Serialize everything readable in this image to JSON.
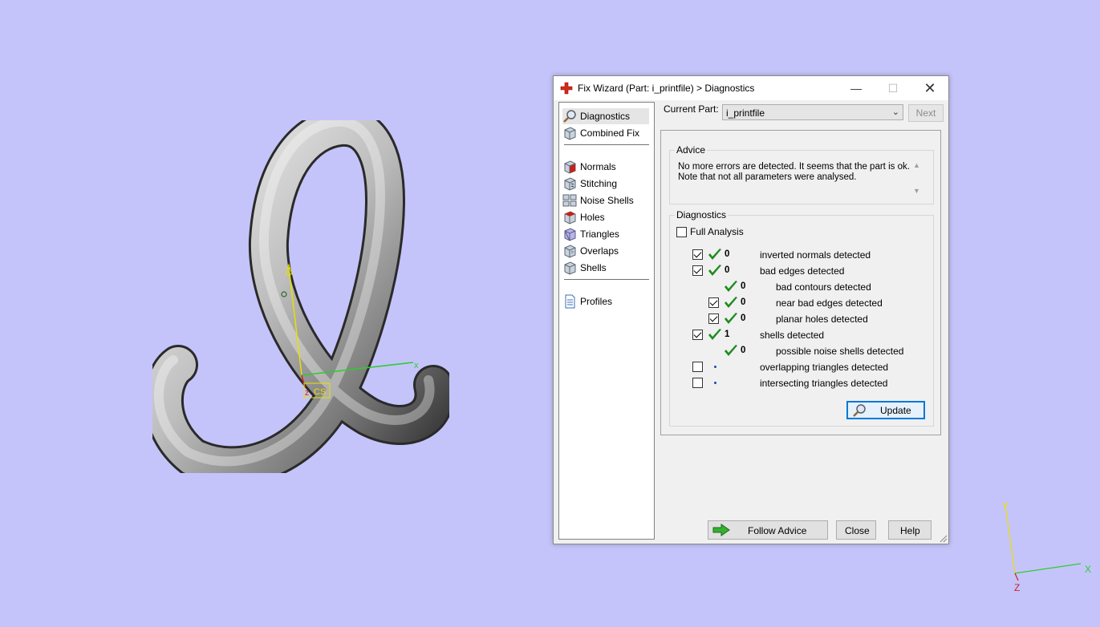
{
  "window": {
    "title": "Fix Wizard (Part: i_printfile) > Diagnostics",
    "min_glyph": "—",
    "max_glyph": "☐",
    "close_glyph": "✕"
  },
  "nav": {
    "items": [
      {
        "label": "Diagnostics",
        "icon": "magnifier-icon",
        "selected": true
      },
      {
        "label": "Combined Fix",
        "icon": "cube-icon"
      },
      {
        "label": "Normals",
        "icon": "normals-cube-icon"
      },
      {
        "label": "Stitching",
        "icon": "stitching-cube-icon"
      },
      {
        "label": "Noise Shells",
        "icon": "noise-shells-icon"
      },
      {
        "label": "Holes",
        "icon": "holes-cube-icon"
      },
      {
        "label": "Triangles",
        "icon": "triangles-cube-icon"
      },
      {
        "label": "Overlaps",
        "icon": "overlaps-cube-icon"
      },
      {
        "label": "Shells",
        "icon": "shells-cube-icon"
      },
      {
        "label": "Profiles",
        "icon": "document-icon"
      }
    ]
  },
  "current_part": {
    "label": "Current Part:",
    "value": "i_printfile",
    "next_label": "Next"
  },
  "advice": {
    "title": "Advice",
    "text": "No more errors are detected. It seems that the part is ok. Note that not all parameters were analysed."
  },
  "diagnostics": {
    "title": "Diagnostics",
    "full_analysis_label": "Full Analysis",
    "full_analysis_checked": false,
    "rows": [
      {
        "label": "inverted normals detected",
        "count": "0",
        "checked": true,
        "status": "ok",
        "level": 0,
        "has_checkbox": true
      },
      {
        "label": "bad edges detected",
        "count": "0",
        "checked": true,
        "status": "ok",
        "level": 0,
        "has_checkbox": true
      },
      {
        "label": "bad contours detected",
        "count": "0",
        "checked": false,
        "status": "ok",
        "level": 1,
        "has_checkbox": false
      },
      {
        "label": "near bad edges detected",
        "count": "0",
        "checked": true,
        "status": "ok",
        "level": 1,
        "has_checkbox": true
      },
      {
        "label": "planar holes detected",
        "count": "0",
        "checked": true,
        "status": "ok",
        "level": 1,
        "has_checkbox": true
      },
      {
        "label": "shells detected",
        "count": "1",
        "checked": true,
        "status": "ok",
        "level": 0,
        "has_checkbox": true
      },
      {
        "label": "possible noise shells detected",
        "count": "0",
        "checked": false,
        "status": "ok",
        "level": 1,
        "has_checkbox": false
      },
      {
        "label": "overlapping triangles detected",
        "count": "",
        "checked": false,
        "status": "none",
        "level": 0,
        "has_checkbox": true
      },
      {
        "label": "intersecting triangles detected",
        "count": "",
        "checked": false,
        "status": "none",
        "level": 0,
        "has_checkbox": true
      }
    ],
    "update_label": "Update"
  },
  "footer": {
    "follow_label": "Follow Advice",
    "close_label": "Close",
    "help_label": "Help"
  },
  "viewport": {
    "model_axis_x": "x",
    "model_axis_z": "z",
    "model_cs_label": "CS",
    "indicator_x": "X",
    "indicator_y": "Y",
    "indicator_z": "Z"
  },
  "colors": {
    "background": "#c4c4fa",
    "check_green": "#1f8b1f",
    "accent_blue": "#0078d7",
    "axis_x": "#2ecc2e",
    "axis_y": "#e8e000",
    "axis_z": "#d02020"
  }
}
